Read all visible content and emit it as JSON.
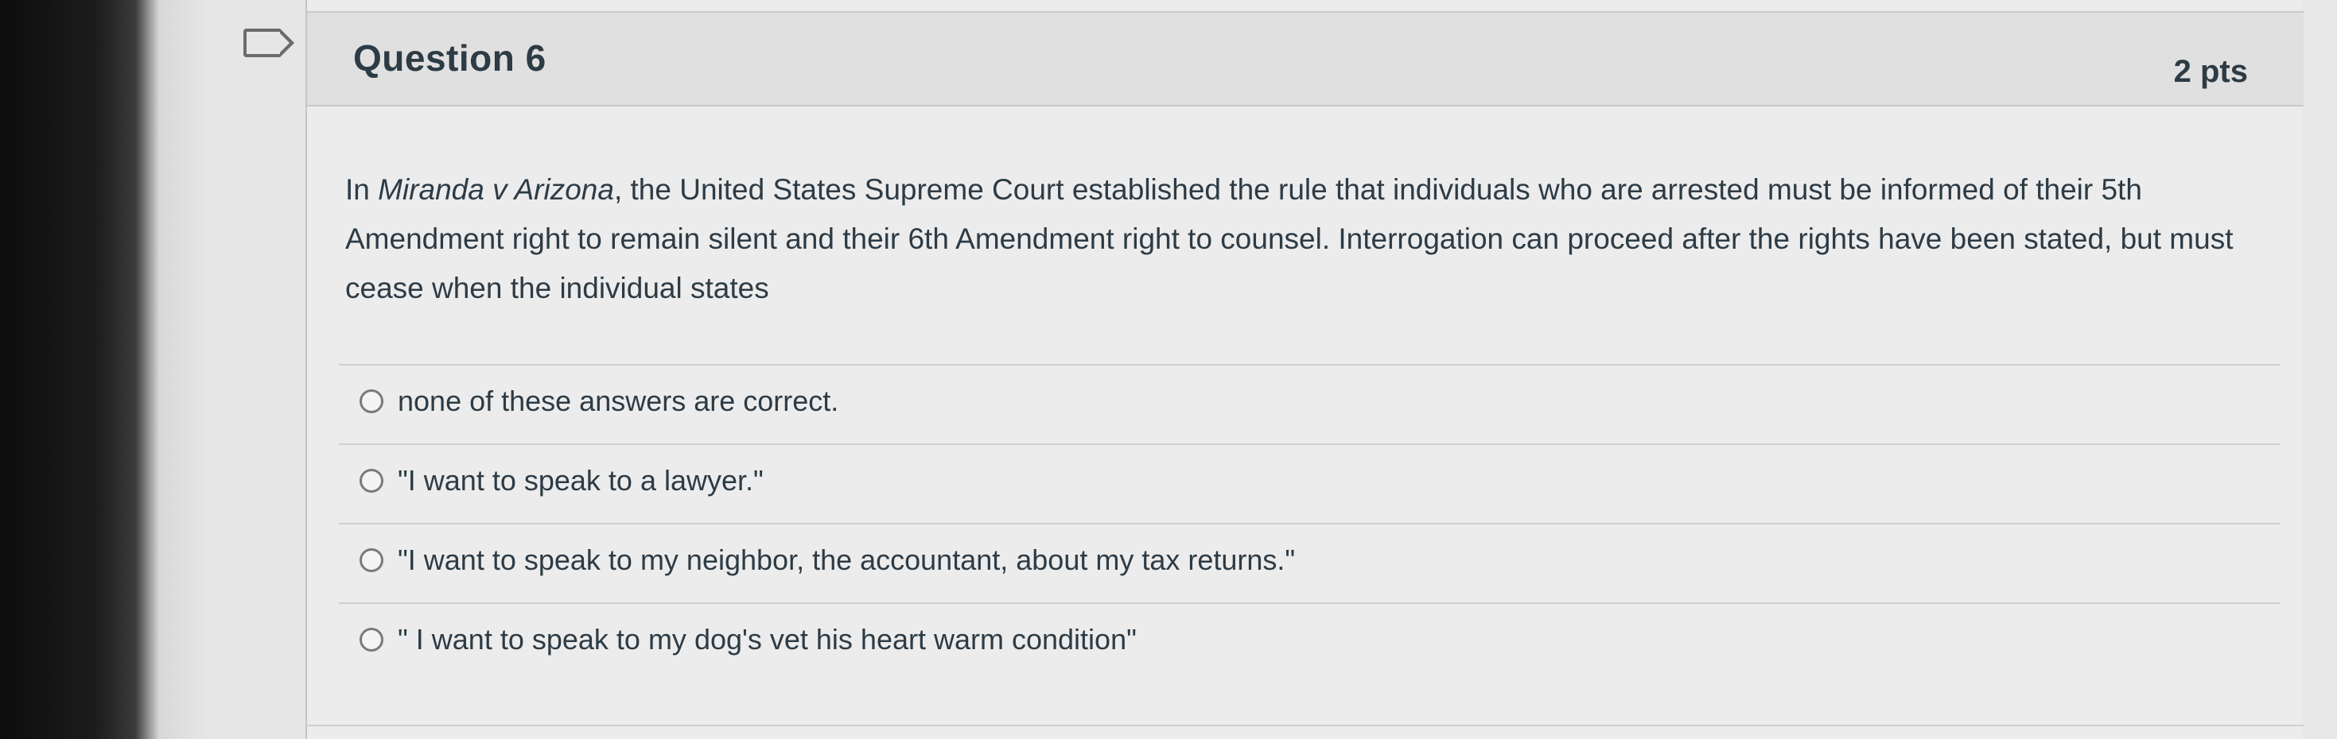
{
  "question": {
    "title": "Question 6",
    "points": "2 pts",
    "text_prefix": "In ",
    "case_name": "Miranda v Arizona",
    "text_rest": ", the United States Supreme Court established the rule that individuals who are arrested must be informed of their 5th Amendment right to remain silent and their 6th Amendment right to counsel. Interrogation can proceed after the rights have been stated, but must cease when the individual states"
  },
  "answers": [
    {
      "label": "none of these answers are correct."
    },
    {
      "label": "\"I want to speak to a lawyer.\""
    },
    {
      "label": "\"I want to speak to my neighbor, the accountant, about my tax returns.\""
    },
    {
      "label": "\" I want to speak to my dog's vet his heart warm condition\""
    }
  ],
  "icons": {
    "bookmark": "bookmark-flag-icon",
    "radio": "radio-unselected-icon"
  },
  "colors": {
    "text": "#2d3b45",
    "header_bg": "#e0e0e0",
    "card_bg": "#ececec"
  }
}
